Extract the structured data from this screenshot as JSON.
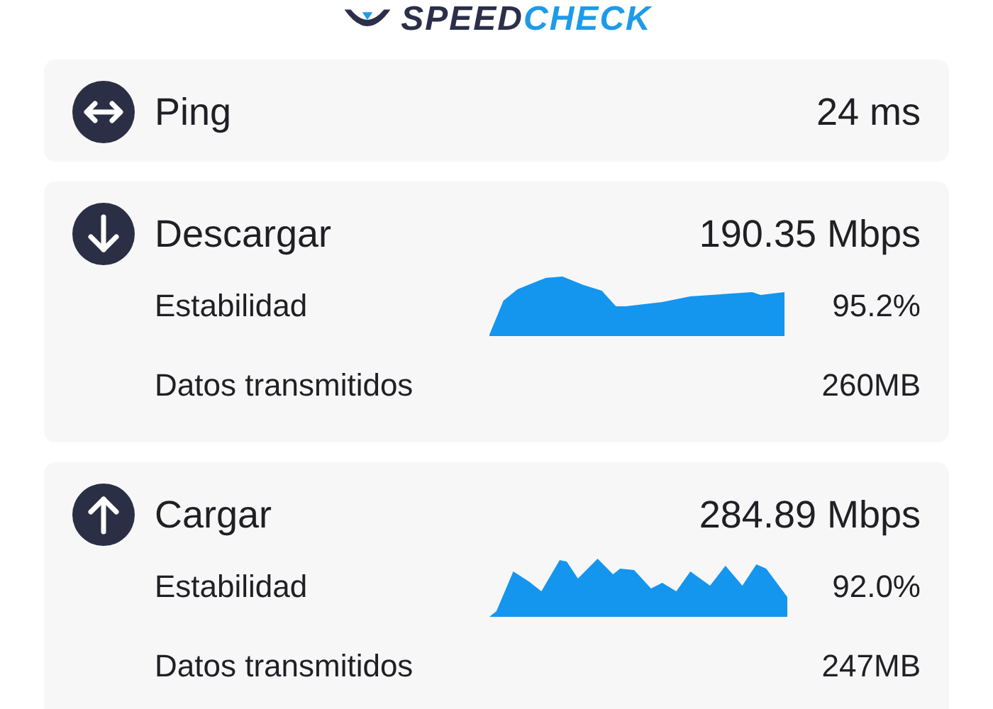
{
  "logo": {
    "text_dark": "SPEED",
    "text_light": "CHECK"
  },
  "sections": [
    {
      "kind": "ping",
      "title": "Ping",
      "value": "24 ms"
    },
    {
      "kind": "download",
      "title": "Descargar",
      "value": "190.35 Mbps",
      "rows": [
        {
          "kind": "graph",
          "label": "Estabilidad",
          "value": "95.2%"
        },
        {
          "kind": "plain",
          "label": "Datos transmitidos",
          "value": "260MB"
        }
      ]
    },
    {
      "kind": "upload",
      "title": "Cargar",
      "value": "284.89 Mbps",
      "rows": [
        {
          "kind": "graph",
          "label": "Estabilidad",
          "value": "92.0%"
        },
        {
          "kind": "plain",
          "label": "Datos transmitidos",
          "value": "247MB"
        }
      ]
    }
  ]
}
